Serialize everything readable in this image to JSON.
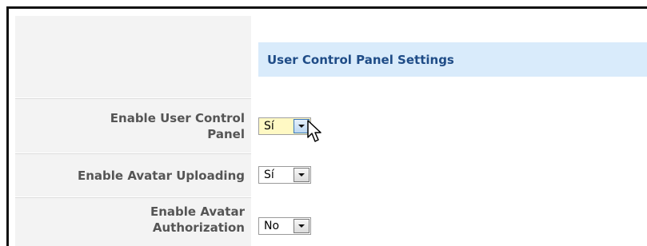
{
  "section": {
    "title": "User Control Panel Settings"
  },
  "rows": [
    {
      "label_line1": "Enable User Control",
      "label_line2": "Panel",
      "value": "Sí"
    },
    {
      "label": "Enable Avatar Uploading",
      "value": "Sí"
    },
    {
      "label_line1": "Enable Avatar",
      "label_line2": "Authorization",
      "value": "No"
    }
  ],
  "icons": {
    "dropdown": "chevron-down-icon",
    "cursor": "mouse-pointer-icon"
  }
}
